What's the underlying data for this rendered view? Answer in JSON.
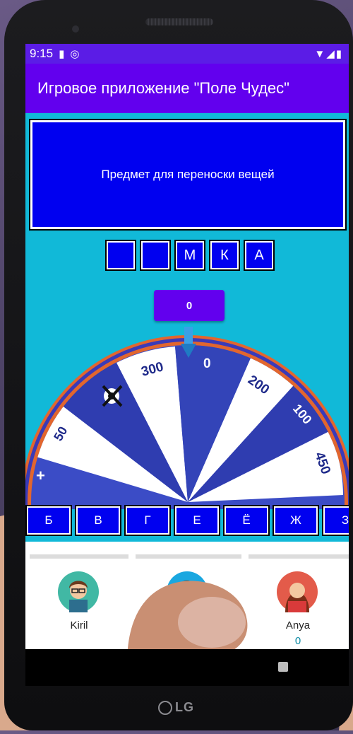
{
  "status_bar": {
    "time": "9:15"
  },
  "app_bar": {
    "title": "Игровое приложение \"Поле Чудес\""
  },
  "question": {
    "text": "Предмет для переноски вещей"
  },
  "word_cells": [
    "",
    "",
    "М",
    "К",
    "А"
  ],
  "score_button": {
    "label": "0"
  },
  "wheel": {
    "sectors": [
      "+",
      "50",
      "bankrupt",
      "300",
      "0",
      "200",
      "100",
      "450"
    ],
    "labels": {
      "plus": "+",
      "s50": "50",
      "s300": "300",
      "s0": "0",
      "s200": "200",
      "s100": "100",
      "s450": "450"
    }
  },
  "letter_buttons": [
    "Б",
    "В",
    "Г",
    "Е",
    "Ё",
    "Ж",
    "З"
  ],
  "players": [
    {
      "name": "Kiril",
      "score": ""
    },
    {
      "name": "",
      "score": ""
    },
    {
      "name": "Anya",
      "score": "0"
    }
  ],
  "device": {
    "brand": "LG"
  },
  "colors": {
    "app_bar": "#6200ee",
    "status_bar": "#5b1ce6",
    "screen_bg": "#11b9d8",
    "cell_blue": "#0000f0"
  }
}
